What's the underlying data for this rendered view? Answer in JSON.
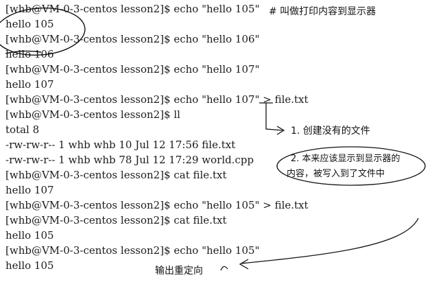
{
  "terminal": {
    "lines": [
      "[whb@VM-0-3-centos lesson2]$ echo \"hello 105\"",
      "hello 105",
      "[whb@VM-0-3-centos lesson2]$ echo \"hello 106\"",
      "hello 106",
      "[whb@VM-0-3-centos lesson2]$ echo \"hello 107\"",
      "hello 107",
      "[whb@VM-0-3-centos lesson2]$ echo \"hello 107\" > file.txt",
      "[whb@VM-0-3-centos lesson2]$ ll",
      "total 8",
      "-rw-rw-r-- 1 whb whb 10 Jul 12 17:56 file.txt",
      "-rw-rw-r-- 1 whb whb 78 Jul 12 17:29 world.cpp",
      "[whb@VM-0-3-centos lesson2]$ cat file.txt",
      "hello 107",
      "[whb@VM-0-3-centos lesson2]$ echo \"hello 105\" > file.txt",
      "[whb@VM-0-3-centos lesson2]$ cat file.txt",
      "hello 105",
      "[whb@VM-0-3-centos lesson2]$ echo \"hello 105\"",
      "hello 105"
    ]
  },
  "annotations": {
    "comment_print": "# 叫做打印内容到显示器",
    "note_create": "1. 创建没有的文件",
    "note_written_line1": "2. 本来应该显示到显示器的",
    "note_written_line2": "内容，被写入到了文件中",
    "label_redirect": "输出重定向"
  },
  "colors": {
    "text": "#1b1b1b",
    "ink": "#111111"
  }
}
